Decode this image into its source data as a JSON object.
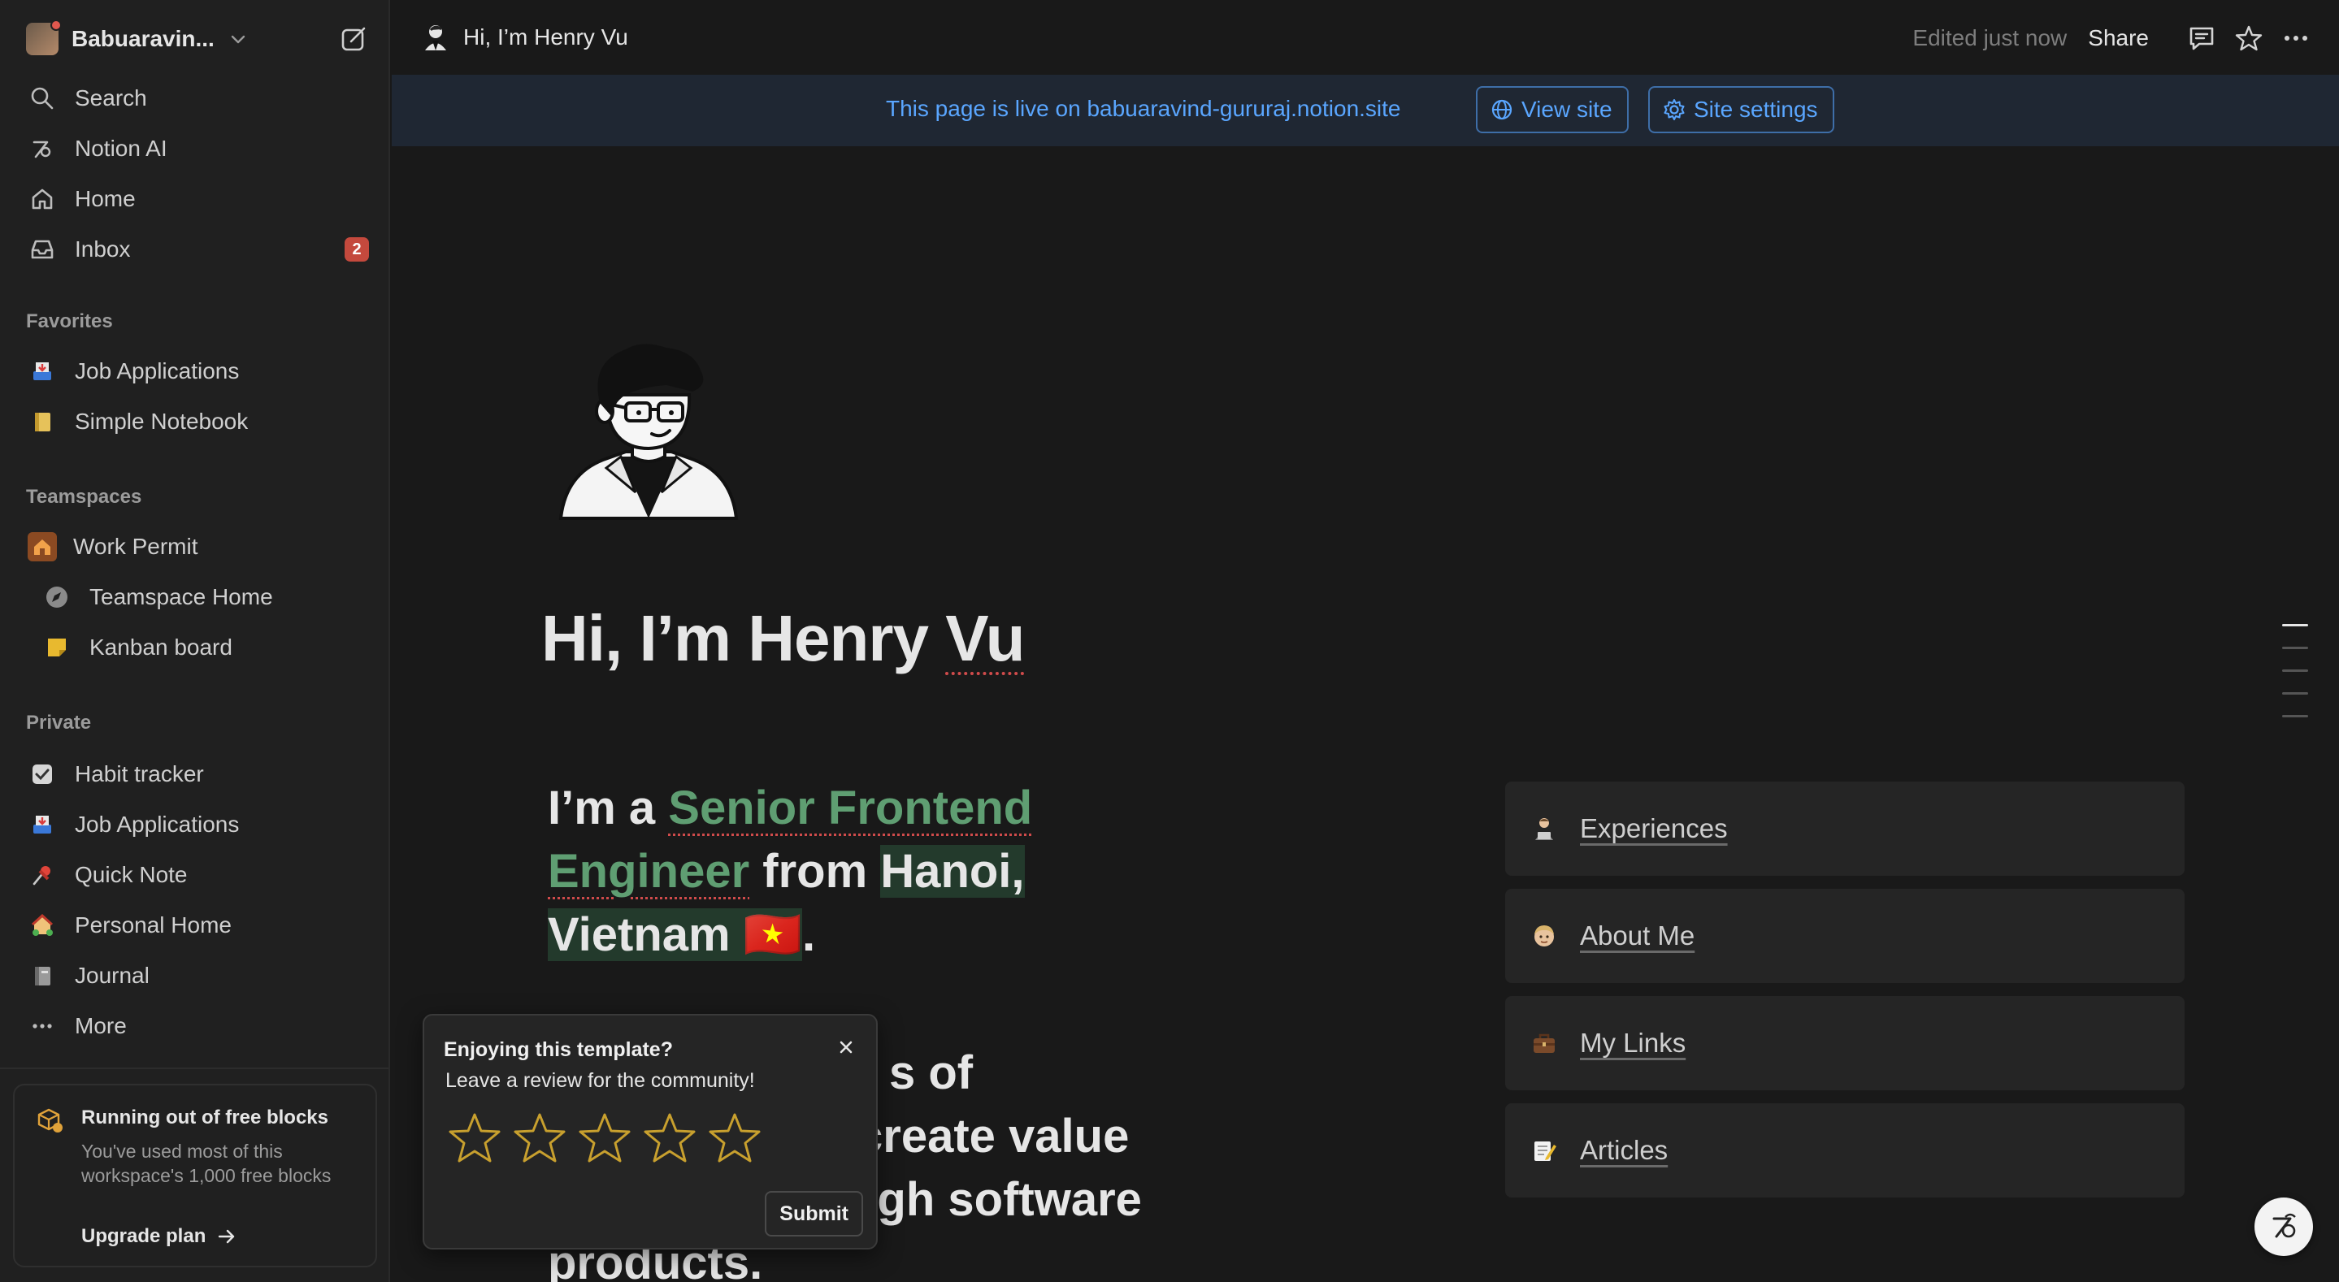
{
  "sidebar": {
    "workspace_name": "Babuaravin...",
    "nav": [
      {
        "label": "Search",
        "icon": "search-icon"
      },
      {
        "label": "Notion AI",
        "icon": "notion-ai-icon"
      },
      {
        "label": "Home",
        "icon": "home-icon"
      },
      {
        "label": "Inbox",
        "icon": "inbox-icon",
        "badge": "2"
      }
    ],
    "favorites_label": "Favorites",
    "favorites": [
      {
        "label": "Job Applications",
        "icon": "inbox-tray-icon"
      },
      {
        "label": "Simple Notebook",
        "icon": "notebook-icon"
      }
    ],
    "teamspaces_label": "Teamspaces",
    "teamspace": {
      "label": "Work Permit",
      "icon": "house-icon"
    },
    "teamspace_pages": [
      {
        "label": "Teamspace Home",
        "icon": "compass-icon"
      },
      {
        "label": "Kanban board",
        "icon": "sticky-note-icon"
      }
    ],
    "private_label": "Private",
    "private": [
      {
        "label": "Habit tracker",
        "icon": "checkbox-icon"
      },
      {
        "label": "Job Applications",
        "icon": "inbox-tray-icon"
      },
      {
        "label": "Quick Note",
        "icon": "pushpin-icon"
      },
      {
        "label": "Personal Home",
        "icon": "house-garden-icon"
      },
      {
        "label": "Journal",
        "icon": "notebook-icon"
      },
      {
        "label": "More",
        "icon": "more-dots-icon"
      }
    ],
    "free_blocks": {
      "title": "Running out of free blocks",
      "body": "You've used most of this workspace's 1,000 free blocks",
      "link": "Upgrade plan"
    }
  },
  "topbar": {
    "page_title": "Hi, I’m Henry Vu",
    "edited": "Edited just now",
    "share": "Share"
  },
  "banner": {
    "text": "This page is live on babuaravind-gururaj.notion.site",
    "view_site": "View site",
    "site_settings": "Site settings"
  },
  "page": {
    "title_main": "Hi, I’m Henry ",
    "title_tail": "Vu",
    "intro": {
      "p1": "I’m a ",
      "role": "Senior Frontend Engineer",
      "p2": " from ",
      "place": "Hanoi, Vietnam",
      "flag": "🇻🇳",
      "p3": "."
    },
    "para2_visible": [
      "s of",
      "create value",
      "ugh software",
      "products."
    ]
  },
  "links": [
    {
      "label": "Experiences",
      "icon": "person-laptop-icon"
    },
    {
      "label": "About Me",
      "icon": "face-icon"
    },
    {
      "label": "My Links",
      "icon": "briefcase-icon"
    },
    {
      "label": "Articles",
      "icon": "memo-icon"
    }
  ],
  "review": {
    "title": "Enjoying this template?",
    "subtitle": "Leave a review for the community!",
    "submit": "Submit",
    "rating": 0,
    "max_rating": 5
  },
  "colors": {
    "accent_blue": "#5aa6ff",
    "green_text": "#5f9e72",
    "badge_red": "#c4493d",
    "star_outline": "#c8a02e"
  }
}
